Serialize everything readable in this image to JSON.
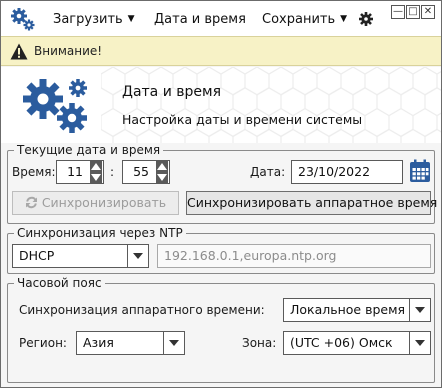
{
  "window": {
    "app_icon": "gears-icon",
    "menu": [
      {
        "label": "Загрузить",
        "has_dropdown": true
      },
      {
        "label": "Дата и время",
        "has_dropdown": false
      },
      {
        "label": "Сохранить",
        "has_dropdown": true
      }
    ],
    "settings_icon": "gear-icon",
    "controls": {
      "minimize": "—",
      "maximize": "□",
      "close": "✕"
    }
  },
  "warning": {
    "icon": "warning-icon",
    "text": "Внимание!",
    "color": "#f7f2c6"
  },
  "header": {
    "icon": "gears-icon",
    "title": "Дата и время",
    "subtitle": "Настройка даты и времени системы"
  },
  "datetime": {
    "legend": "Текущие дата и время",
    "time_label": "Время:",
    "hours": "11",
    "separator": ":",
    "minutes": "55",
    "date_label": "Дата:",
    "date_value": "23/10/2022",
    "calendar_icon": "calendar-icon",
    "sync_button": {
      "label": "Синхронизировать",
      "enabled": false,
      "icon": "refresh-icon"
    },
    "sync_hw_button": {
      "label": "Синхронизировать аппаратное время"
    }
  },
  "ntp": {
    "legend": "Синхронизация через NTP",
    "mode_value": "DHCP",
    "servers_value": "192.168.0.1,europa.ntp.org"
  },
  "timezone": {
    "legend": "Часовой пояс",
    "hw_sync_label": "Синхронизация аппаратного времени:",
    "hw_sync_value": "Локальное время",
    "region_label": "Регион:",
    "region_value": "Азия",
    "zone_label": "Зона:",
    "zone_value": "(UTC +06) Омск"
  },
  "colors": {
    "accent_blue": "#2b5c9e",
    "warning_bg": "#f7f2c6"
  }
}
